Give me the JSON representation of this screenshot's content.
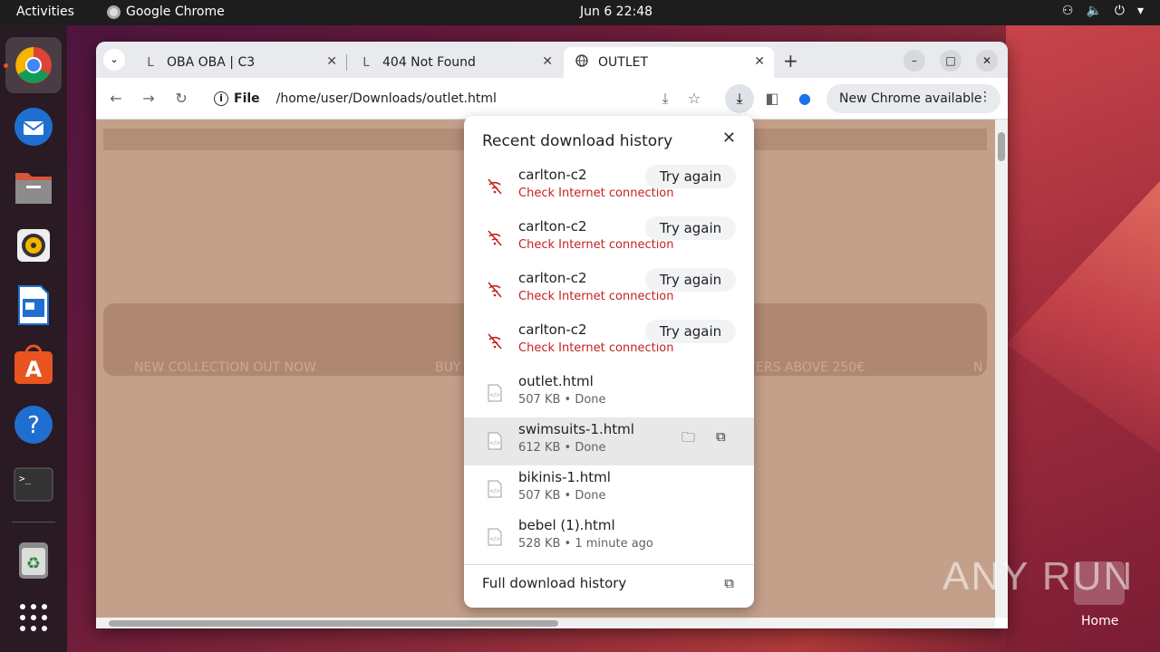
{
  "topbar": {
    "activities": "Activities",
    "app_name": "Google Chrome",
    "clock": "Jun 6  22:48"
  },
  "tabs": [
    {
      "label": "OBA OBA | C3",
      "favicon": "L"
    },
    {
      "label": "404 Not Found",
      "favicon": "L"
    },
    {
      "label": "OUTLET",
      "favicon": "globe-icon"
    }
  ],
  "toolbar": {
    "scheme": "File",
    "url": "/home/user/Downloads/outlet.html",
    "new_chrome": "New Chrome available"
  },
  "page": {
    "promo": [
      "NEW COLLECTION OUT NOW",
      "BUY",
      "ERS ABOVE 250€",
      "N"
    ]
  },
  "downloads": {
    "title": "Recent download history",
    "items": [
      {
        "name": "carlton-c2",
        "sub": "Check Internet connection",
        "status": "error",
        "action": "Try again"
      },
      {
        "name": "carlton-c2",
        "sub": "Check Internet connection",
        "status": "error",
        "action": "Try again"
      },
      {
        "name": "carlton-c2",
        "sub": "Check Internet connection",
        "status": "error",
        "action": "Try again"
      },
      {
        "name": "carlton-c2",
        "sub": "Check Internet connection",
        "status": "error",
        "action": "Try again"
      },
      {
        "name": "outlet.html",
        "sub": "507 KB • Done",
        "status": "done"
      },
      {
        "name": "swimsuits-1.html",
        "sub": "612 KB • Done",
        "status": "done"
      },
      {
        "name": "bikinis-1.html",
        "sub": "507 KB • Done",
        "status": "done"
      },
      {
        "name": "bebel (1).html",
        "sub": "528 KB • 1 minute ago",
        "status": "done"
      }
    ],
    "full_history": "Full download history"
  },
  "desktop": {
    "watermark": "ANY RUN",
    "home_label": "Home"
  },
  "colors": {
    "accent": "#e95420",
    "error": "#c5221f",
    "page_bg": "#c4a08a"
  }
}
